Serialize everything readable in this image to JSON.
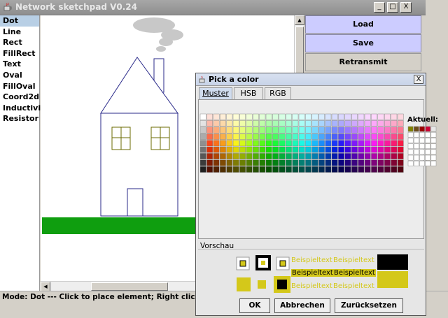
{
  "window": {
    "title": "Network sketchpad V0.24",
    "controls": [
      "_",
      "□",
      "X"
    ]
  },
  "tools": [
    "Dot",
    "Line",
    "Rect",
    "FillRect",
    "Text",
    "Oval",
    "FillOval",
    "Coord2d",
    "Inductivity",
    "Resistor"
  ],
  "selected_tool": "Dot",
  "actions": {
    "load": "Load",
    "save": "Save",
    "retransmit": "Retransmit"
  },
  "status": "Mode: Dot  ---  Click to place element; Right click: Abort/F",
  "colors": {
    "accent_button": "#ccccff",
    "grass": "#0f9e0f",
    "smoke": "#c8c8c8",
    "house_stroke": "#2a2a8a",
    "window_stroke": "#6b6b00",
    "preview_color": "#d4c81a"
  },
  "dialog": {
    "title": "Pick a color",
    "close": "X",
    "tabs": [
      "Muster",
      "HSB",
      "RGB"
    ],
    "active_tab": "Muster",
    "recent_label": "Aktuell:",
    "preview_label": "Vorschau",
    "sample_text": "Beispieltext",
    "buttons": {
      "ok": "OK",
      "cancel": "Abbrechen",
      "reset": "Zurücksetzen"
    }
  }
}
